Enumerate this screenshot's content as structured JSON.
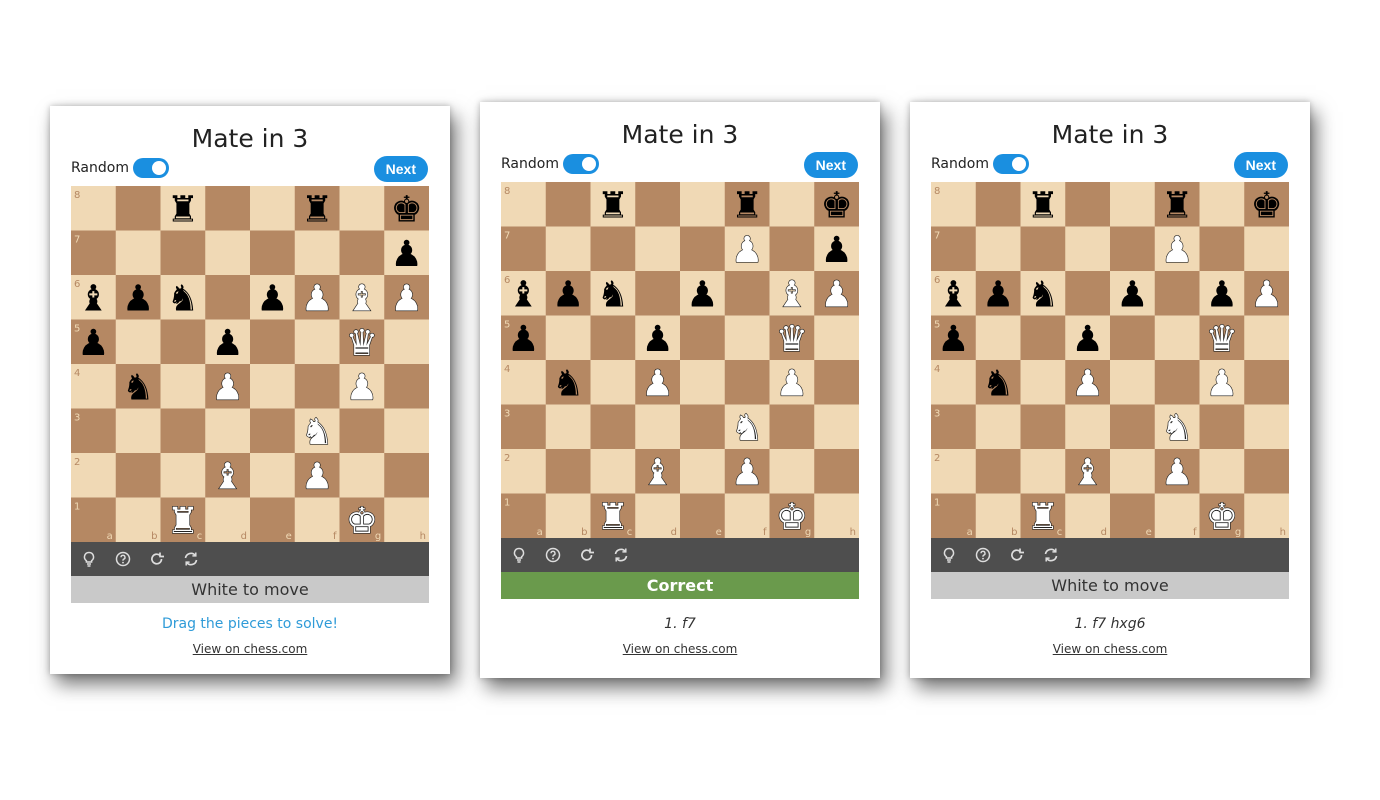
{
  "cards": [
    {
      "title": "Mate in 3",
      "random_label": "Random",
      "next_label": "Next",
      "status": "White to move",
      "status_type": "neutral",
      "hint": "Drag the pieces to solve!",
      "moves": "",
      "link": "View on chess.com",
      "pieces": [
        {
          "sq": "c8",
          "p": "bR"
        },
        {
          "sq": "f8",
          "p": "bR"
        },
        {
          "sq": "h8",
          "p": "bK"
        },
        {
          "sq": "h7",
          "p": "bP"
        },
        {
          "sq": "a6",
          "p": "bB"
        },
        {
          "sq": "b6",
          "p": "bP"
        },
        {
          "sq": "c6",
          "p": "bN"
        },
        {
          "sq": "e6",
          "p": "bP"
        },
        {
          "sq": "f6",
          "p": "wP"
        },
        {
          "sq": "g6",
          "p": "wB"
        },
        {
          "sq": "h6",
          "p": "wP"
        },
        {
          "sq": "a5",
          "p": "bP"
        },
        {
          "sq": "d5",
          "p": "bP"
        },
        {
          "sq": "g5",
          "p": "wQ"
        },
        {
          "sq": "b4",
          "p": "bN"
        },
        {
          "sq": "d4",
          "p": "wP"
        },
        {
          "sq": "g4",
          "p": "wP"
        },
        {
          "sq": "f3",
          "p": "wN"
        },
        {
          "sq": "d2",
          "p": "wB"
        },
        {
          "sq": "f2",
          "p": "wP"
        },
        {
          "sq": "c1",
          "p": "wR"
        },
        {
          "sq": "g1",
          "p": "wK"
        }
      ]
    },
    {
      "title": "Mate in 3",
      "random_label": "Random",
      "next_label": "Next",
      "status": "Correct",
      "status_type": "correct",
      "hint": "",
      "moves": "1. f7",
      "link": "View on chess.com",
      "pieces": [
        {
          "sq": "c8",
          "p": "bR"
        },
        {
          "sq": "f8",
          "p": "bR"
        },
        {
          "sq": "h8",
          "p": "bK"
        },
        {
          "sq": "f7",
          "p": "wP"
        },
        {
          "sq": "h7",
          "p": "bP"
        },
        {
          "sq": "a6",
          "p": "bB"
        },
        {
          "sq": "b6",
          "p": "bP"
        },
        {
          "sq": "c6",
          "p": "bN"
        },
        {
          "sq": "e6",
          "p": "bP"
        },
        {
          "sq": "g6",
          "p": "wB"
        },
        {
          "sq": "h6",
          "p": "wP"
        },
        {
          "sq": "a5",
          "p": "bP"
        },
        {
          "sq": "d5",
          "p": "bP"
        },
        {
          "sq": "g5",
          "p": "wQ"
        },
        {
          "sq": "b4",
          "p": "bN"
        },
        {
          "sq": "d4",
          "p": "wP"
        },
        {
          "sq": "g4",
          "p": "wP"
        },
        {
          "sq": "f3",
          "p": "wN"
        },
        {
          "sq": "d2",
          "p": "wB"
        },
        {
          "sq": "f2",
          "p": "wP"
        },
        {
          "sq": "c1",
          "p": "wR"
        },
        {
          "sq": "g1",
          "p": "wK"
        }
      ]
    },
    {
      "title": "Mate in 3",
      "random_label": "Random",
      "next_label": "Next",
      "status": "White to move",
      "status_type": "neutral",
      "hint": "",
      "moves": "1. f7 hxg6",
      "link": "View on chess.com",
      "pieces": [
        {
          "sq": "c8",
          "p": "bR"
        },
        {
          "sq": "f8",
          "p": "bR"
        },
        {
          "sq": "h8",
          "p": "bK"
        },
        {
          "sq": "f7",
          "p": "wP"
        },
        {
          "sq": "a6",
          "p": "bB"
        },
        {
          "sq": "b6",
          "p": "bP"
        },
        {
          "sq": "c6",
          "p": "bN"
        },
        {
          "sq": "e6",
          "p": "bP"
        },
        {
          "sq": "g6",
          "p": "bP"
        },
        {
          "sq": "h6",
          "p": "wP"
        },
        {
          "sq": "a5",
          "p": "bP"
        },
        {
          "sq": "d5",
          "p": "bP"
        },
        {
          "sq": "g5",
          "p": "wQ"
        },
        {
          "sq": "b4",
          "p": "bN"
        },
        {
          "sq": "d4",
          "p": "wP"
        },
        {
          "sq": "g4",
          "p": "wP"
        },
        {
          "sq": "f3",
          "p": "wN"
        },
        {
          "sq": "d2",
          "p": "wB"
        },
        {
          "sq": "f2",
          "p": "wP"
        },
        {
          "sq": "c1",
          "p": "wR"
        },
        {
          "sq": "g1",
          "p": "wK"
        }
      ]
    }
  ],
  "ranks": [
    "8",
    "7",
    "6",
    "5",
    "4",
    "3",
    "2",
    "1"
  ],
  "files": [
    "a",
    "b",
    "c",
    "d",
    "e",
    "f",
    "g",
    "h"
  ],
  "toolbar_icons": [
    "lightbulb-icon",
    "help-icon",
    "redo-icon",
    "refresh-icon"
  ],
  "colors": {
    "light_square": "#f0d9b5",
    "dark_square": "#b58863",
    "accent_blue": "#1a8fe0",
    "correct_green": "#6a9a4c",
    "toolbar": "#4e4e4e"
  }
}
